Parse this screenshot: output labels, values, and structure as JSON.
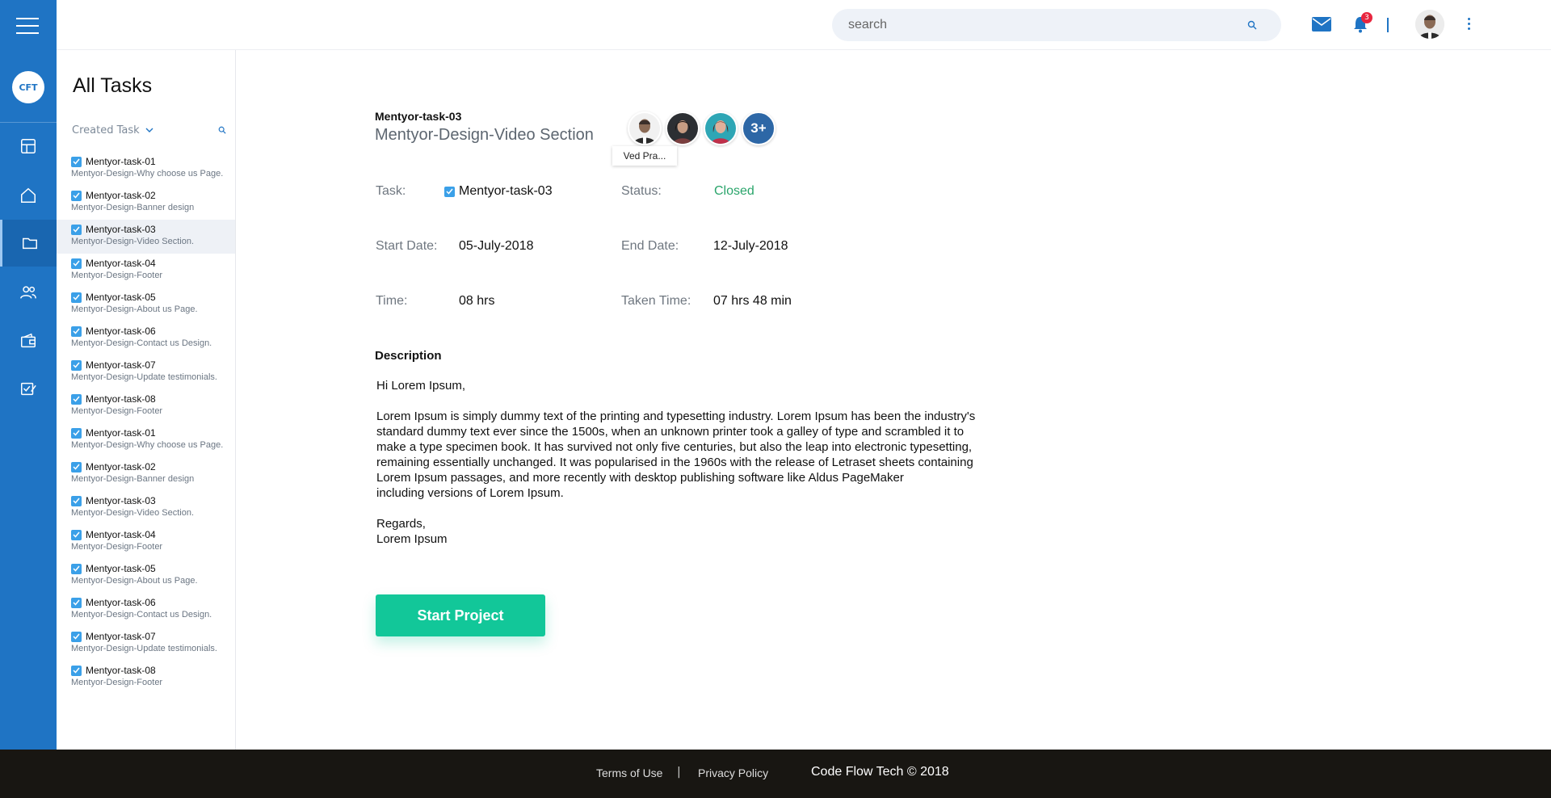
{
  "header": {
    "search_placeholder": "search",
    "notification_count": "3",
    "icons": [
      "menu-icon",
      "mail-icon",
      "bell-icon",
      "more-vertical-icon"
    ]
  },
  "sidebar": {
    "logo_text": "CFT",
    "nav": [
      "dashboard-icon",
      "home-icon",
      "folder-icon",
      "users-icon",
      "wallet-icon",
      "tasks-icon"
    ],
    "active_item": "folder-icon"
  },
  "task_panel": {
    "title": "All Tasks",
    "filter_label": "Created Task",
    "tasks": [
      {
        "name": "Mentyor-task-01",
        "desc": "Mentyor-Design-Why choose us Page."
      },
      {
        "name": "Mentyor-task-02",
        "desc": "Mentyor-Design-Banner design"
      },
      {
        "name": "Mentyor-task-03",
        "desc": "Mentyor-Design-Video Section."
      },
      {
        "name": "Mentyor-task-04",
        "desc": "Mentyor-Design-Footer"
      },
      {
        "name": "Mentyor-task-05",
        "desc": "Mentyor-Design-About us Page."
      },
      {
        "name": "Mentyor-task-06",
        "desc": "Mentyor-Design-Contact us Design."
      },
      {
        "name": "Mentyor-task-07",
        "desc": "Mentyor-Design-Update testimonials."
      },
      {
        "name": "Mentyor-task-08",
        "desc": "Mentyor-Design-Footer"
      },
      {
        "name": "Mentyor-task-01",
        "desc": "Mentyor-Design-Why choose us Page."
      },
      {
        "name": "Mentyor-task-02",
        "desc": "Mentyor-Design-Banner design"
      },
      {
        "name": "Mentyor-task-03",
        "desc": "Mentyor-Design-Video Section."
      },
      {
        "name": "Mentyor-task-04",
        "desc": "Mentyor-Design-Footer"
      },
      {
        "name": "Mentyor-task-05",
        "desc": "Mentyor-Design-About us Page."
      },
      {
        "name": "Mentyor-task-06",
        "desc": "Mentyor-Design-Contact us Design."
      },
      {
        "name": "Mentyor-task-07",
        "desc": "Mentyor-Design-Update testimonials."
      },
      {
        "name": "Mentyor-task-08",
        "desc": "Mentyor-Design-Footer"
      }
    ],
    "selected_task": "Mentyor-task-03"
  },
  "detail": {
    "task_id": "Mentyor-task-03",
    "title": "Mentyor-Design-Video Section",
    "more_members": "3+",
    "tooltip": "Ved Pra...",
    "fields": {
      "task_label": "Task:",
      "task_value": "Mentyor-task-03",
      "status_label": "Status:",
      "status_value": "Closed",
      "start_label": "Start Date:",
      "start_value": "05-July-2018",
      "end_label": "End Date:",
      "end_value": "12-July-2018",
      "time_label": "Time:",
      "time_value": "08 hrs",
      "taken_label": "Taken Time:",
      "taken_value": "07 hrs 48 min"
    },
    "description_heading": "Description",
    "description": {
      "greeting": "Hi Lorem Ipsum,",
      "lines": [
        "Lorem Ipsum is simply dummy text of the printing and typesetting industry. Lorem Ipsum has been the industry's",
        "standard dummy text ever since the 1500s, when an unknown printer took a galley of type and scrambled it to",
        "make a type specimen book. It has survived not only five centuries, but also the leap into electronic typesetting,",
        "remaining essentially unchanged. It was popularised in the 1960s with the release of Letraset sheets containing",
        "Lorem Ipsum passages, and more recently with desktop publishing software like Aldus PageMaker",
        "including versions of Lorem Ipsum."
      ],
      "signoff": "Regards,",
      "signature": "Lorem Ipsum"
    },
    "button_label": "Start Project",
    "colors": {
      "accent": "#1f74c4",
      "status_closed": "#2aa56b",
      "button": "#12c799"
    }
  },
  "footer": {
    "terms": "Terms of Use",
    "separator": "|",
    "privacy": "Privacy Policy",
    "copyright": "Code Flow Tech © 2018"
  }
}
